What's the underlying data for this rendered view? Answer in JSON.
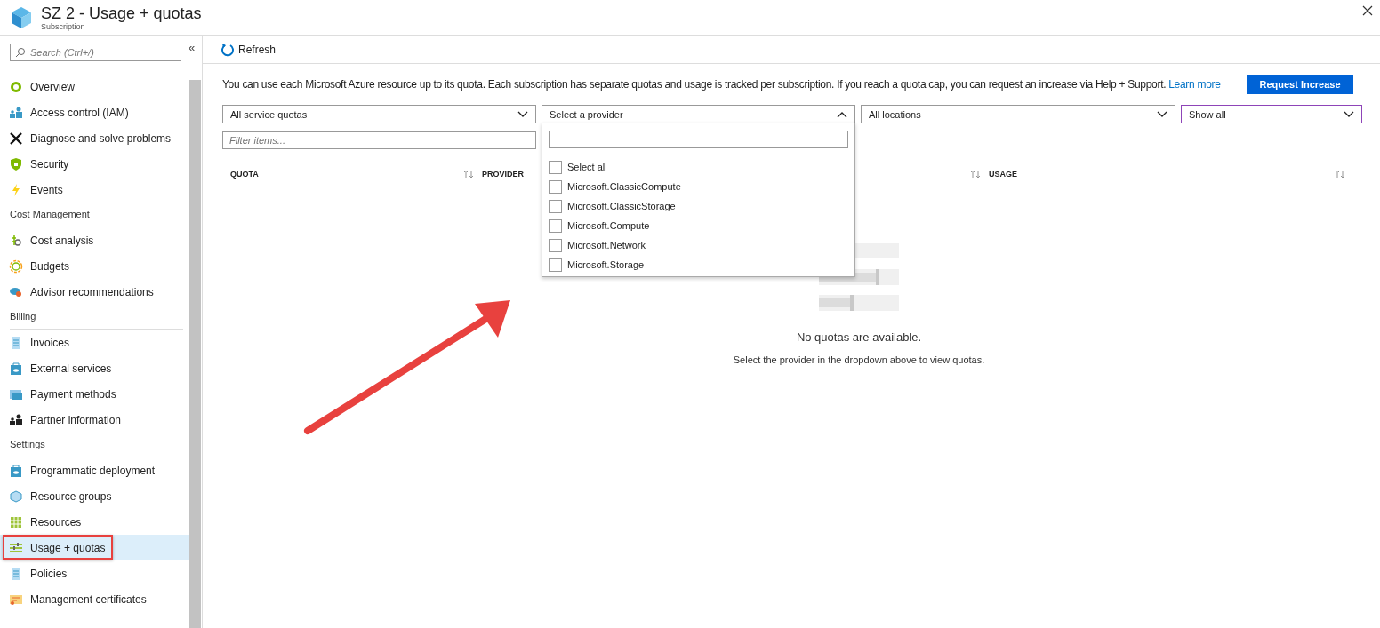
{
  "header": {
    "title": "SZ 2 - Usage + quotas",
    "subtitle": "Subscription"
  },
  "sidebar": {
    "search_placeholder": "Search (Ctrl+/)",
    "collapse": "«",
    "groups": [
      {
        "items": [
          {
            "label": "Overview",
            "selected": false,
            "highlighted": false
          },
          {
            "label": "Access control (IAM)",
            "selected": false,
            "highlighted": false
          },
          {
            "label": "Diagnose and solve problems",
            "selected": false,
            "highlighted": false
          },
          {
            "label": "Security",
            "selected": false,
            "highlighted": false
          },
          {
            "label": "Events",
            "selected": false,
            "highlighted": false
          }
        ]
      },
      {
        "heading": "Cost Management",
        "items": [
          {
            "label": "Cost analysis",
            "selected": false,
            "highlighted": false
          },
          {
            "label": "Budgets",
            "selected": false,
            "highlighted": false
          },
          {
            "label": "Advisor recommendations",
            "selected": false,
            "highlighted": false
          }
        ]
      },
      {
        "heading": "Billing",
        "items": [
          {
            "label": "Invoices",
            "selected": false,
            "highlighted": false
          },
          {
            "label": "External services",
            "selected": false,
            "highlighted": false
          },
          {
            "label": "Payment methods",
            "selected": false,
            "highlighted": false
          },
          {
            "label": "Partner information",
            "selected": false,
            "highlighted": false
          }
        ]
      },
      {
        "heading": "Settings",
        "items": [
          {
            "label": "Programmatic deployment",
            "selected": false,
            "highlighted": false
          },
          {
            "label": "Resource groups",
            "selected": false,
            "highlighted": false
          },
          {
            "label": "Resources",
            "selected": false,
            "highlighted": false
          },
          {
            "label": "Usage + quotas",
            "selected": true,
            "highlighted": true
          },
          {
            "label": "Policies",
            "selected": false,
            "highlighted": false
          },
          {
            "label": "Management certificates",
            "selected": false,
            "highlighted": false
          }
        ]
      }
    ]
  },
  "toolbar": {
    "refresh": "Refresh"
  },
  "info": {
    "text": "You can use each Microsoft Azure resource up to its quota. Each subscription has separate quotas and usage is tracked per subscription. If you reach a quota cap, you can request an increase via Help + Support.",
    "link": "Learn more"
  },
  "request_button": "Request Increase",
  "filters": [
    {
      "value": "All service quotas",
      "expanded": false,
      "focused": false
    },
    {
      "value": "Select a provider",
      "expanded": true,
      "focused": false
    },
    {
      "value": "All locations",
      "expanded": false,
      "focused": false
    },
    {
      "value": "Show all",
      "expanded": false,
      "focused": true
    }
  ],
  "filter_field": {
    "placeholder": "Filter items..."
  },
  "provider_menu": {
    "options": [
      {
        "label": "Select all",
        "checked": false
      },
      {
        "label": "Microsoft.ClassicCompute",
        "checked": false
      },
      {
        "label": "Microsoft.ClassicStorage",
        "checked": false
      },
      {
        "label": "Microsoft.Compute",
        "checked": false
      },
      {
        "label": "Microsoft.Network",
        "checked": false
      },
      {
        "label": "Microsoft.Storage",
        "checked": false
      }
    ]
  },
  "table": {
    "columns": [
      {
        "label": "QUOTA",
        "sort_icon": true
      },
      {
        "label": "PROVIDER",
        "sort_icon": false
      },
      {
        "sort_icon": true
      },
      {
        "label": "USAGE",
        "sort_icon": true
      }
    ]
  },
  "empty_state": {
    "title": "No quotas are available.",
    "message": "Select the provider in the dropdown above to view quotas."
  }
}
